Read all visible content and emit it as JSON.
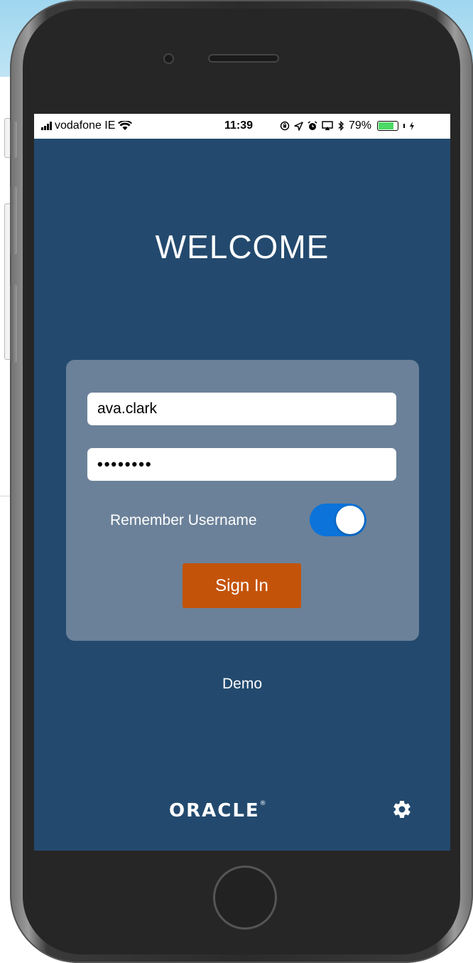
{
  "status_bar": {
    "carrier": "vodafone IE",
    "time": "11:39",
    "battery_percent": "79%",
    "battery_level": 0.79,
    "icons": [
      "signal-icon",
      "wifi-icon",
      "lock-rotation-icon",
      "location-icon",
      "alarm-icon",
      "airplay-icon",
      "bluetooth-icon",
      "battery-icon",
      "charging-icon"
    ]
  },
  "login": {
    "title": "WELCOME",
    "username_value": "ava.clark",
    "password_value": "••••••••",
    "remember_label": "Remember Username",
    "remember_on": true,
    "sign_in_label": "Sign In"
  },
  "demo_link": "Demo",
  "footer": {
    "logo_text": "ORACLE",
    "logo_mark": "®",
    "settings_icon": "gear-icon"
  },
  "colors": {
    "screen_bg": "#234a6e",
    "card_bg": "#6b8199",
    "sign_in_bg": "#c4530a",
    "toggle_on": "#0b73d9"
  }
}
